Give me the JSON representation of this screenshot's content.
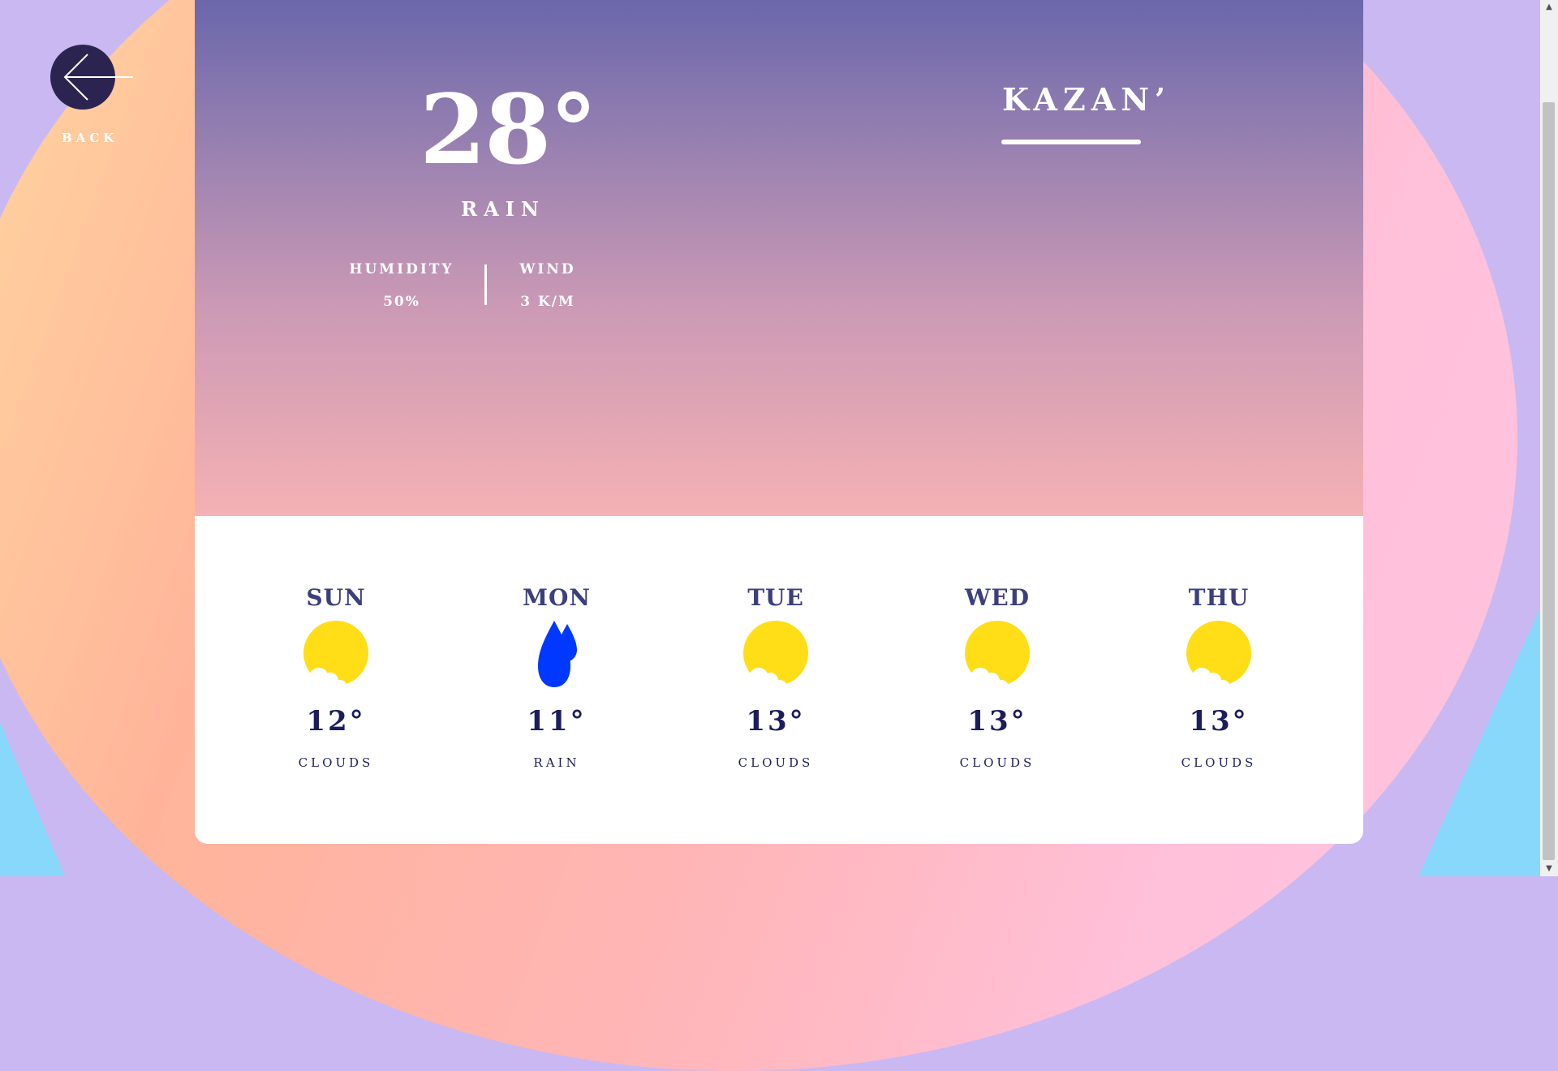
{
  "back": {
    "label": "BACK",
    "icon": "arrow-left-icon"
  },
  "current": {
    "temperature": "28°",
    "condition": "RAIN",
    "humidity_label": "HUMIDITY",
    "humidity_value": "50%",
    "wind_label": "WIND",
    "wind_value": "3 K/M",
    "city": "KAZAN’"
  },
  "forecast": [
    {
      "day": "SUN",
      "temp": "12°",
      "desc": "CLOUDS",
      "icon": "sun-clouds-icon"
    },
    {
      "day": "MON",
      "temp": "11°",
      "desc": "RAIN",
      "icon": "raindrops-icon"
    },
    {
      "day": "TUE",
      "temp": "13°",
      "desc": "CLOUDS",
      "icon": "sun-clouds-icon"
    },
    {
      "day": "WED",
      "temp": "13°",
      "desc": "CLOUDS",
      "icon": "sun-clouds-icon"
    },
    {
      "day": "THU",
      "temp": "13°",
      "desc": "CLOUDS",
      "icon": "sun-clouds-icon"
    }
  ],
  "colors": {
    "back_button": "#2b2450",
    "sun": "#ffde17",
    "rain": "#0038ff",
    "day_name": "#3b3f7d",
    "forecast_text": "#1b1d5c"
  }
}
